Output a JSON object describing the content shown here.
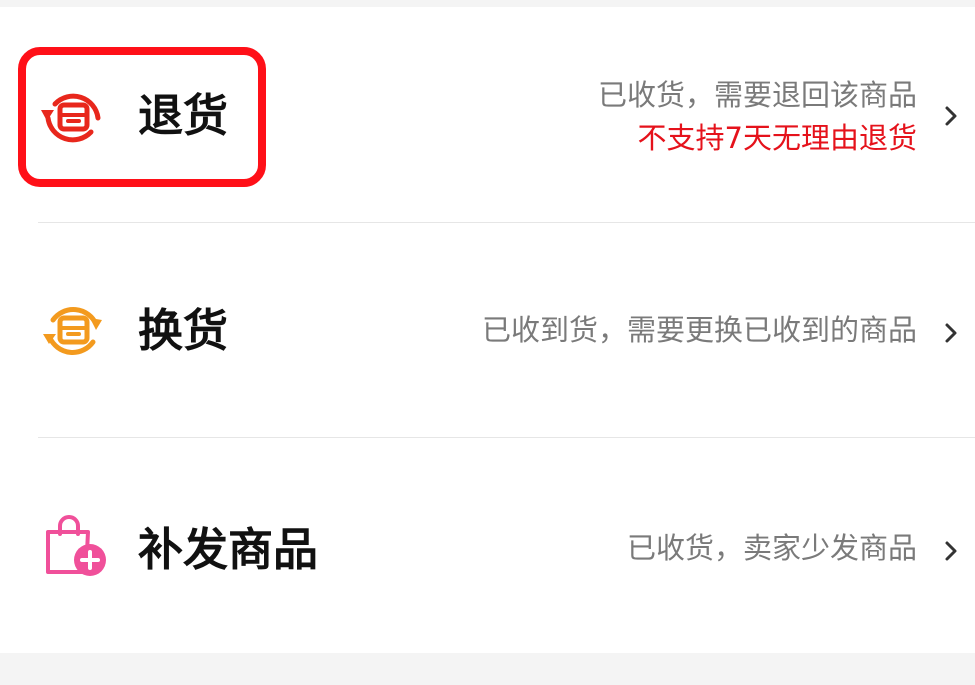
{
  "options": [
    {
      "title": "退货",
      "description": "已收货，需要退回该商品",
      "warning": "不支持7天无理由退货",
      "icon": "return-box-icon"
    },
    {
      "title": "换货",
      "description": "已收到货，需要更换已收到的商品",
      "icon": "exchange-box-icon"
    },
    {
      "title": "补发商品",
      "description": "已收货，卖家少发商品",
      "icon": "reship-bag-icon"
    }
  ],
  "colors": {
    "return_icon": "#e8271c",
    "exchange_icon": "#f39a1e",
    "reship_icon": "#f0509a",
    "warning_text": "#e5121b",
    "highlight_border": "#ff1018",
    "description_text": "#7a7a7a",
    "title_text": "#111111"
  },
  "chevron_icon": "chevron-right-icon"
}
